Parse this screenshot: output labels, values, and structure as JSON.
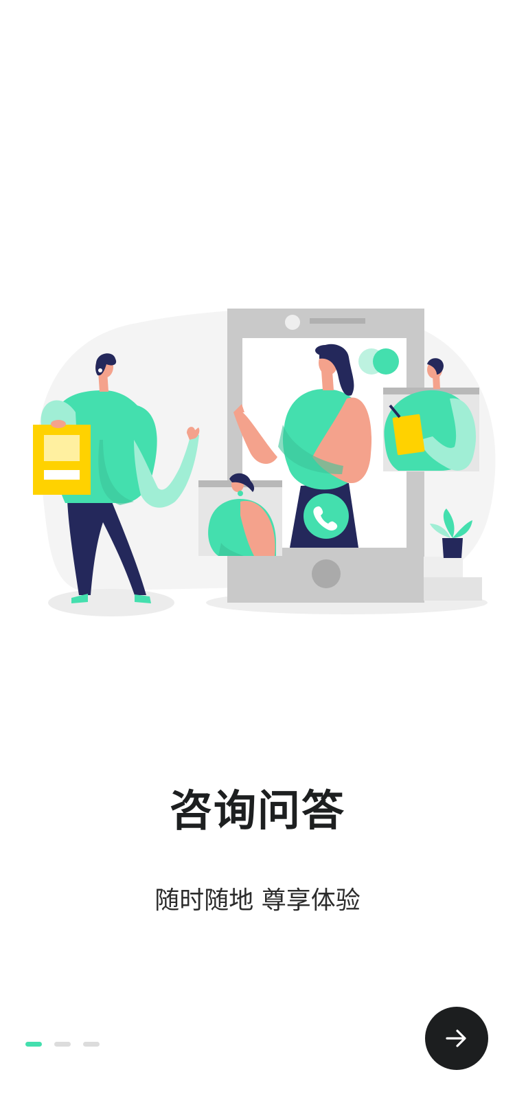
{
  "onboarding": {
    "title": "咨询问答",
    "subtitle": "随时随地 尊享体验",
    "current_page": 1,
    "total_pages": 3,
    "next_button_icon": "arrow-right-icon"
  },
  "colors": {
    "accent": "#44dfae",
    "dark": "#1c1e1f",
    "navy": "#24285b",
    "skin": "#f4a28c",
    "yellow": "#ffd200",
    "gray": "#c9c9c9"
  }
}
